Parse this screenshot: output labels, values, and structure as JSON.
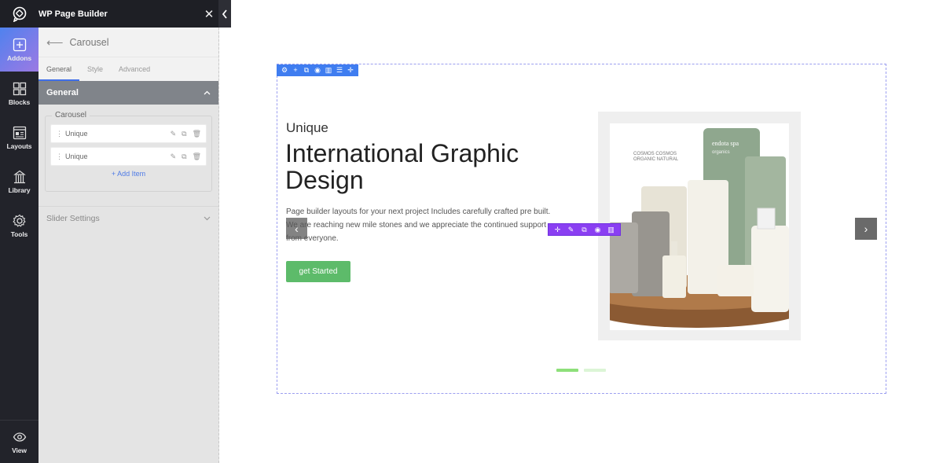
{
  "topbar": {
    "title": "WP Page Builder",
    "close_icon": "close-icon",
    "collapse_icon": "chevron-left-icon"
  },
  "rail": {
    "items": [
      {
        "label": "Addons",
        "icon": "plus-square-icon",
        "active": true
      },
      {
        "label": "Blocks",
        "icon": "blocks-icon",
        "active": false
      },
      {
        "label": "Layouts",
        "icon": "layouts-icon",
        "active": false
      },
      {
        "label": "Library",
        "icon": "library-icon",
        "active": false
      },
      {
        "label": "Tools",
        "icon": "gear-icon",
        "active": false
      }
    ],
    "view": {
      "label": "View",
      "icon": "eye-icon"
    }
  },
  "panel": {
    "back_icon": "arrow-left-icon",
    "title": "Carousel",
    "tabs": [
      {
        "label": "General",
        "active": true
      },
      {
        "label": "Style",
        "active": false
      },
      {
        "label": "Advanced",
        "active": false
      }
    ],
    "section_general": "General",
    "fieldset_legend": "Carousel",
    "items": [
      {
        "label": "Unique"
      },
      {
        "label": "Unique"
      }
    ],
    "add_item": "Add Item",
    "slider_settings": "Slider Settings"
  },
  "canvas": {
    "row_toolbar": [
      "gear",
      "+",
      "copy",
      "eye",
      "trash",
      "columns",
      "move"
    ],
    "subtitle": "Unique",
    "headline": "International Graphic Design",
    "description": "Page builder layouts for your next project Includes carefully crafted pre built. We are reaching new mile stones and we appreciate the continued support from everyone.",
    "cta_label": "get Started",
    "prev_label": "‹",
    "next_label": "›",
    "addon_toolbar": [
      "move",
      "edit",
      "copy",
      "eye",
      "trash"
    ],
    "image_alt": "endota spa organics products",
    "image_label_brand": "endota spa",
    "image_label_sub": "organics",
    "dots": {
      "count": 2,
      "active_index": 0
    },
    "colors": {
      "accent": "#5dbb6a",
      "row_toolbar": "#3f7df0",
      "addon_toolbar": "#8a3ff2"
    }
  }
}
